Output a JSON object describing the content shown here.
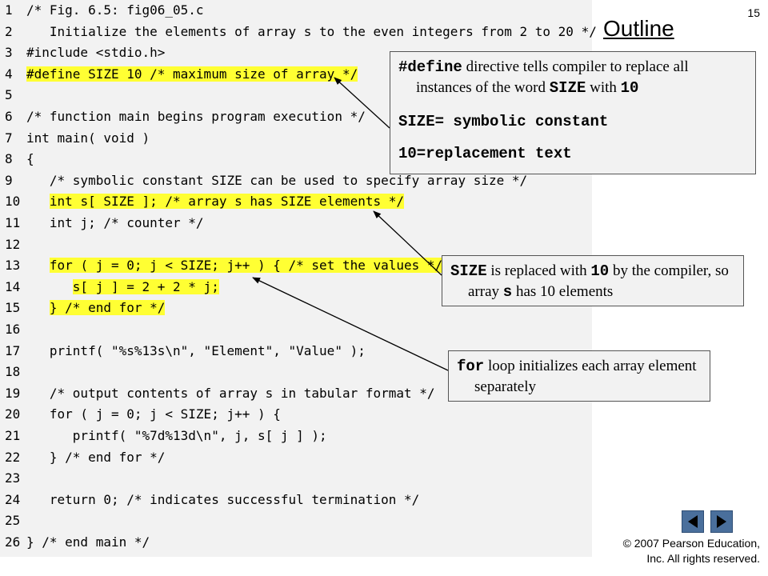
{
  "page_number": "15",
  "outline_title": "Outline",
  "code_lines": [
    {
      "n": "1",
      "text": "/* Fig. 6.5: fig06_05.c",
      "hl": false,
      "hl_start": 0
    },
    {
      "n": "2",
      "text": "   Initialize the elements of array s to the even integers from 2 to 20 */",
      "hl": false,
      "hl_start": 0
    },
    {
      "n": "3",
      "text": "#include <stdio.h>",
      "hl": false,
      "hl_start": 0
    },
    {
      "n": "4",
      "text": "#define SIZE 10 /* maximum size of array */",
      "hl": true,
      "hl_start": 0
    },
    {
      "n": "5",
      "text": "",
      "hl": false,
      "hl_start": 0
    },
    {
      "n": "6",
      "text": "/* function main begins program execution */",
      "hl": false,
      "hl_start": 0
    },
    {
      "n": "7",
      "text": "int main( void )",
      "hl": false,
      "hl_start": 0
    },
    {
      "n": "8",
      "text": "{",
      "hl": false,
      "hl_start": 0
    },
    {
      "n": "9",
      "text": "   /* symbolic constant SIZE can be used to specify array size */",
      "hl": false,
      "hl_start": 0
    },
    {
      "n": "10",
      "text": "   int s[ SIZE ]; /* array s has SIZE elements */",
      "hl": true,
      "hl_start": 3
    },
    {
      "n": "11",
      "text": "   int j; /* counter */",
      "hl": false,
      "hl_start": 0
    },
    {
      "n": "12",
      "text": "",
      "hl": false,
      "hl_start": 0
    },
    {
      "n": "13",
      "text": "   for ( j = 0; j < SIZE; j++ ) { /* set the values */",
      "hl": true,
      "hl_start": 3
    },
    {
      "n": "14",
      "text": "      s[ j ] = 2 + 2 * j;",
      "hl": true,
      "hl_start": 6
    },
    {
      "n": "15",
      "text": "   } /* end for */",
      "hl": true,
      "hl_start": 3
    },
    {
      "n": "16",
      "text": "",
      "hl": false,
      "hl_start": 0
    },
    {
      "n": "17",
      "text": "   printf( \"%s%13s\\n\", \"Element\", \"Value\" );",
      "hl": false,
      "hl_start": 0
    },
    {
      "n": "18",
      "text": "",
      "hl": false,
      "hl_start": 0
    },
    {
      "n": "19",
      "text": "   /* output contents of array s in tabular format */",
      "hl": false,
      "hl_start": 0
    },
    {
      "n": "20",
      "text": "   for ( j = 0; j < SIZE; j++ ) {",
      "hl": false,
      "hl_start": 0
    },
    {
      "n": "21",
      "text": "      printf( \"%7d%13d\\n\", j, s[ j ] );",
      "hl": false,
      "hl_start": 0
    },
    {
      "n": "22",
      "text": "   } /* end for */",
      "hl": false,
      "hl_start": 0
    },
    {
      "n": "23",
      "text": "",
      "hl": false,
      "hl_start": 0
    },
    {
      "n": "24",
      "text": "   return 0; /* indicates successful termination */",
      "hl": false,
      "hl_start": 0
    },
    {
      "n": "25",
      "text": "",
      "hl": false,
      "hl_start": 0
    },
    {
      "n": "26",
      "text": "} /* end main */",
      "hl": false,
      "hl_start": 0
    }
  ],
  "callouts": {
    "define": {
      "p1_code1": "#define",
      "p1_text1": " directive tells compiler to replace all instances of the word ",
      "p1_code2": "SIZE",
      "p1_text2": " with ",
      "p1_code3": "10",
      "p2": "SIZE= symbolic constant",
      "p3": "10=replacement text"
    },
    "size": {
      "code1": "SIZE",
      "text1": " is replaced with ",
      "code2": "10",
      "text2": " by the compiler, so array ",
      "code3": "s",
      "text3": " has 10 elements"
    },
    "for_loop": {
      "code1": "for",
      "text1": " loop initializes each array element separately"
    }
  },
  "nav": {
    "prev_icon": "triangle-left-icon",
    "next_icon": "triangle-right-icon"
  },
  "copyright": {
    "line1": "© 2007 Pearson Education,",
    "line2": "Inc.  All rights reserved."
  },
  "colors": {
    "highlight": "#ffff33",
    "panel_bg": "#f2f2f2",
    "nav_button": "#4a6f9c"
  }
}
